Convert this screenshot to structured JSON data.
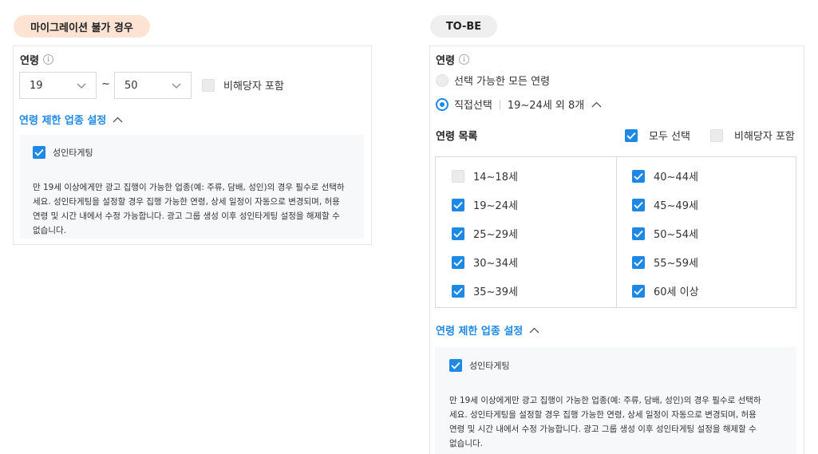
{
  "left": {
    "badge": "마이그레이션 불가 경우",
    "age_label": "연령",
    "info_symbol": "i",
    "from_value": "19",
    "range_sep": "~",
    "to_value": "50",
    "nontarget_label": "비해당자 포함",
    "restrict_link": "연령 제한 업종 설정",
    "adult_label": "성인타게팅",
    "desc_lines": [
      "만 19세 이상에게만 광고 집행이 가능한 업종(예: 주류, 담배, 성인)의 경우 필수로 선택하",
      "세요. 성인타게팅을 설정할 경우 집행 가능한 연령, 상세 일정이 자동으로 변경되며, 허용",
      "연령 및 시간 내에서 수정 가능합니다. 광고 그룹 생성 이후 성인타게팅 설정을 해제할 수",
      "없습니다."
    ]
  },
  "right": {
    "badge": "TO-BE",
    "age_label": "연령",
    "info_symbol": "i",
    "option_all": "선택 가능한 모든 연령",
    "option_direct": "직접선택",
    "direct_summary": "19~24세 외 8개",
    "list_title": "연령 목록",
    "select_all": "모두 선택",
    "nontarget_label": "비해당자 포함",
    "ages_left": [
      {
        "label": "14~18세",
        "checked": false
      },
      {
        "label": "19~24세",
        "checked": true
      },
      {
        "label": "25~29세",
        "checked": true
      },
      {
        "label": "30~34세",
        "checked": true
      },
      {
        "label": "35~39세",
        "checked": true
      }
    ],
    "ages_right": [
      {
        "label": "40~44세",
        "checked": true
      },
      {
        "label": "45~49세",
        "checked": true
      },
      {
        "label": "50~54세",
        "checked": true
      },
      {
        "label": "55~59세",
        "checked": true
      },
      {
        "label": "60세 이상",
        "checked": true
      }
    ],
    "restrict_link": "연령 제한 업종 설정",
    "adult_label": "성인타게팅",
    "desc_lines": [
      "만 19세 이상에게만 광고 집행이 가능한 업종(예: 주류, 담배, 성인)의 경우 필수로 선택하",
      "세요. 성인타게팅을 설정할 경우 집행 가능한 연령, 상세 일정이 자동으로 변경되며, 허용",
      "연령 및 시간 내에서 수정 가능합니다. 광고 그룹 생성 이후 성인타게팅 설정을 해제할 수",
      "없습니다."
    ]
  },
  "colors": {
    "accent": "#1e88e5",
    "badge_left": "#fde3d3",
    "badge_right": "#efefef"
  }
}
